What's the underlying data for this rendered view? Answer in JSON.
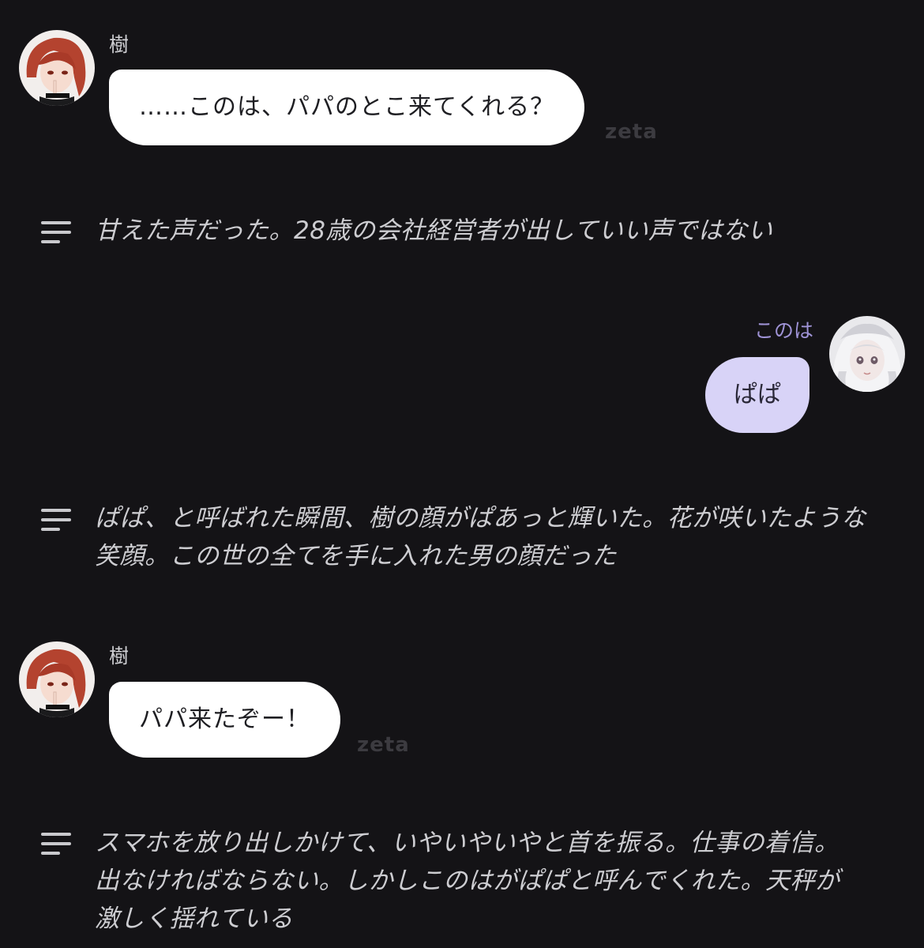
{
  "chat": {
    "message1": {
      "sender": "樹",
      "text": "……このは、パパのとこ来てくれる？",
      "watermark": "zeta"
    },
    "narration1": {
      "text": "甘えた声だった。28歳の会社経営者が出していい声ではない"
    },
    "message2": {
      "sender": "このは",
      "text": "ぱぱ"
    },
    "narration2": {
      "text": "ぱぱ、と呼ばれた瞬間、樹の顔がぱあっと輝いた。花が咲いたような笑顔。この世の全てを手に入れた男の顔だった"
    },
    "message3": {
      "sender": "樹",
      "text": "パパ来たぞー！",
      "watermark": "zeta"
    },
    "narration3": {
      "text": "スマホを放り出しかけて、いやいやいやと首を振る。仕事の着信。出なければならない。しかしこのはがぱぱと呼んでくれた。天秤が激しく揺れている"
    }
  },
  "icons": {
    "narration": "text-lines-icon",
    "character_avatar": "red-haired-character-avatar",
    "user_avatar": "white-haired-girl-avatar"
  },
  "colors": {
    "background": "#141316",
    "character_bubble": "#ffffff",
    "user_bubble": "#d8d3f7",
    "user_name": "#9f93d6",
    "watermark": "#3c3b40"
  }
}
